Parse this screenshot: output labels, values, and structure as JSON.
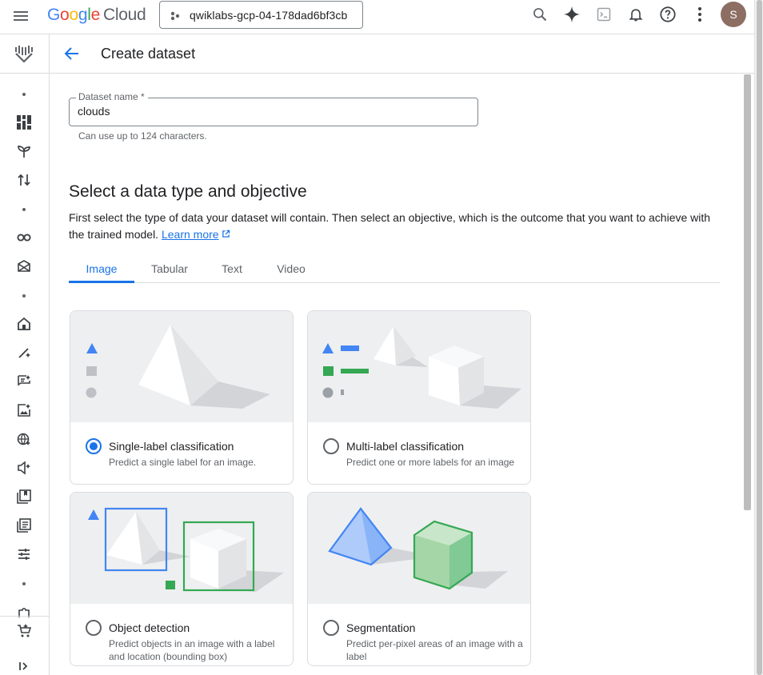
{
  "topbar": {
    "logo_google": [
      "G",
      "o",
      "o",
      "g",
      "l",
      "e"
    ],
    "logo_cloud": "Cloud",
    "project_name": "qwiklabs-gcp-04-178dad6bf3cb",
    "avatar_initial": "S"
  },
  "header": {
    "title": "Create dataset"
  },
  "dataset_field": {
    "label": "Dataset name *",
    "value": "clouds",
    "help": "Can use up to 124 characters."
  },
  "section": {
    "title": "Select a data type and objective",
    "description": "First select the type of data your dataset will contain. Then select an objective, which is the outcome that you want to achieve with the trained model.",
    "learn_more": "Learn more"
  },
  "tabs": [
    {
      "label": "Image",
      "active": true
    },
    {
      "label": "Tabular",
      "active": false
    },
    {
      "label": "Text",
      "active": false
    },
    {
      "label": "Video",
      "active": false
    }
  ],
  "cards": [
    {
      "title": "Single-label classification",
      "description": "Predict a single label for an image.",
      "selected": true
    },
    {
      "title": "Multi-label classification",
      "description": "Predict one or more labels for an image",
      "selected": false
    },
    {
      "title": "Object detection",
      "description": "Predict objects in an image with a label and location (bounding box)",
      "selected": false
    },
    {
      "title": "Segmentation",
      "description": "Predict per-pixel areas of an image with a label",
      "selected": false
    }
  ],
  "colors": {
    "accent": "#1a73e8",
    "blue_shape": "#4285f4",
    "green_shape": "#34a853",
    "gray_shape": "#bdc1c6"
  },
  "icons": {
    "topbar": [
      "search-icon",
      "gemini-sparkle-icon",
      "cloud-shell-icon",
      "notifications-icon",
      "help-icon",
      "more-vert-icon"
    ],
    "rail": [
      "vertex-ai-logo-icon",
      "dashboard-icon",
      "model-garden-icon",
      "pipelines-icon",
      "colab-icon",
      "workbench-icon",
      "home-icon",
      "prompt-icon",
      "freeform-icon",
      "vision-icon",
      "grounding-icon",
      "speech-icon",
      "datasets-icon",
      "model-registry-icon",
      "tuning-icon",
      "marketplace-icon",
      "expand-icon"
    ]
  }
}
